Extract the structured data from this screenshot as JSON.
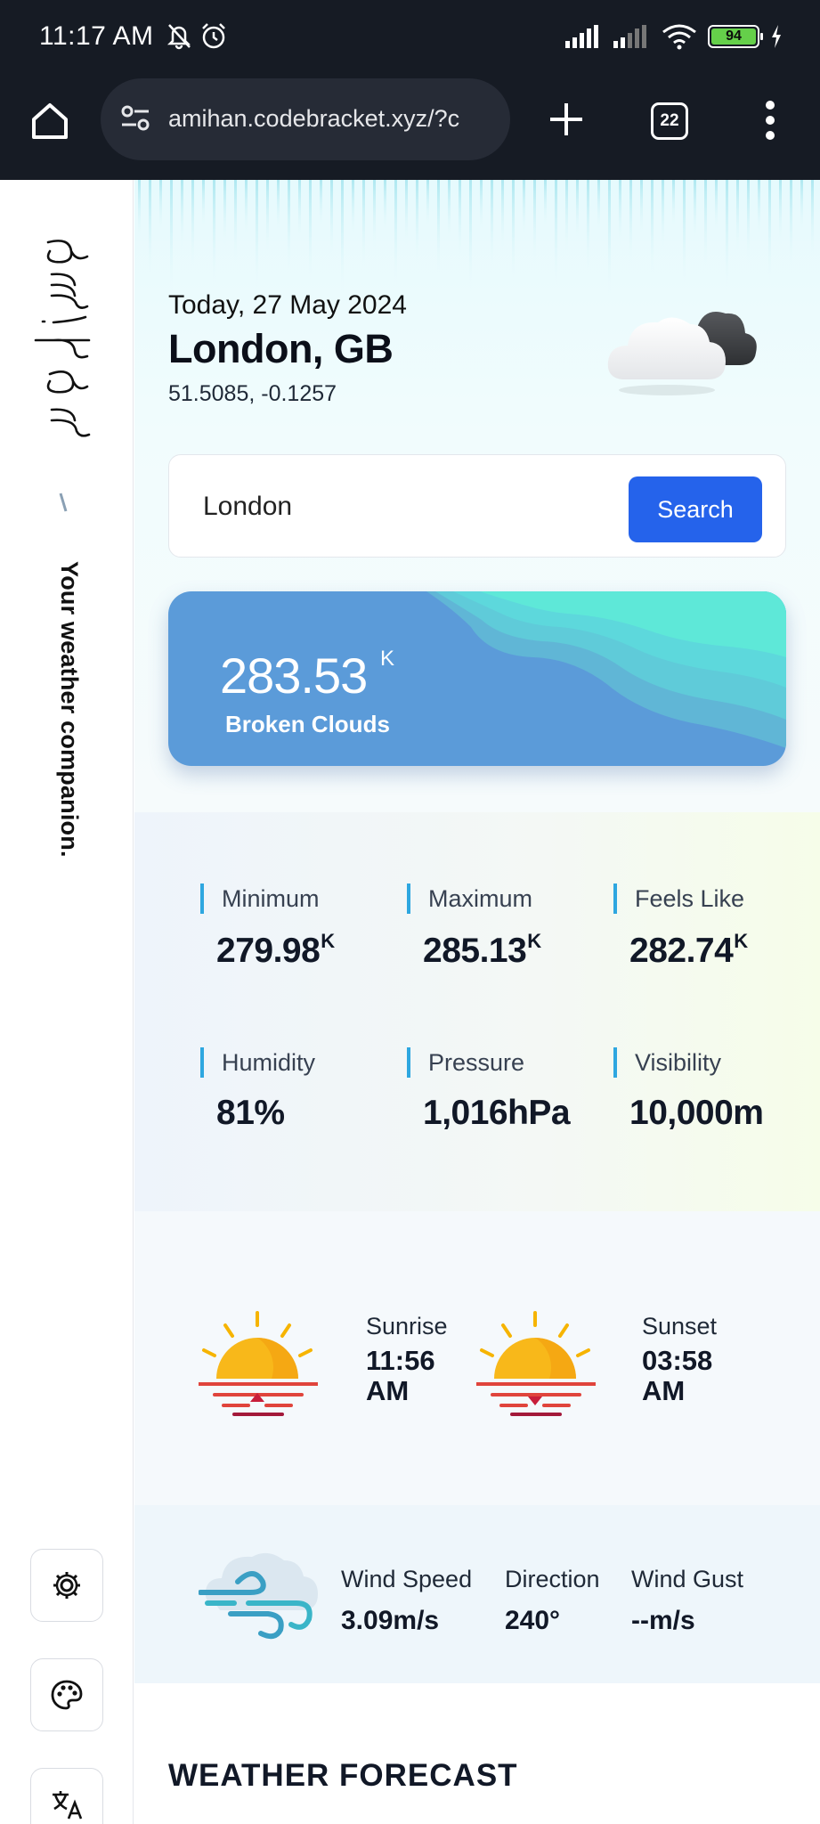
{
  "status_bar": {
    "time": "11:17 AM",
    "battery": "94"
  },
  "browser": {
    "url": "amihan.codebracket.xyz/?c",
    "tab_count": "22"
  },
  "sidebar": {
    "logo_text": "amihan",
    "separator": "/",
    "tagline": "Your weather companion.",
    "buttons": [
      "gear-icon",
      "palette-icon",
      "translate-icon"
    ]
  },
  "header": {
    "date_prefix": "Today,",
    "date": "27 May 2024",
    "city": "London, GB",
    "coordinates": "51.5085, -0.1257",
    "weather_icon": "broken-clouds-icon"
  },
  "search": {
    "value": "London",
    "button_label": "Search"
  },
  "current": {
    "temperature": "283.53",
    "unit": "K",
    "description": "Broken Clouds"
  },
  "stats": [
    {
      "label": "Minimum",
      "value": "279.98",
      "unit": "K"
    },
    {
      "label": "Maximum",
      "value": "285.13",
      "unit": "K"
    },
    {
      "label": "Feels Like",
      "value": "282.74",
      "unit": "K"
    },
    {
      "label": "Humidity",
      "value": "81%",
      "unit": ""
    },
    {
      "label": "Pressure",
      "value": "1,016hPa",
      "unit": ""
    },
    {
      "label": "Visibility",
      "value": "10,000m",
      "unit": ""
    }
  ],
  "sun": {
    "sunrise_label": "Sunrise",
    "sunrise_time": "11:56",
    "sunrise_period": "AM",
    "sunset_label": "Sunset",
    "sunset_time": "03:58",
    "sunset_period": "AM"
  },
  "wind": {
    "speed_label": "Wind Speed",
    "speed_value": "3.09m/s",
    "direction_label": "Direction",
    "direction_value": "240°",
    "gust_label": "Wind Gust",
    "gust_value": "--m/s"
  },
  "forecast": {
    "heading": "WEATHER FORECAST"
  },
  "colors": {
    "accent_blue": "#2563eb",
    "card_blue": "#5b9bd9",
    "wave_teal": "#5ee8d8",
    "stat_marker": "#2ea7e0",
    "status_bg": "#161b24"
  }
}
